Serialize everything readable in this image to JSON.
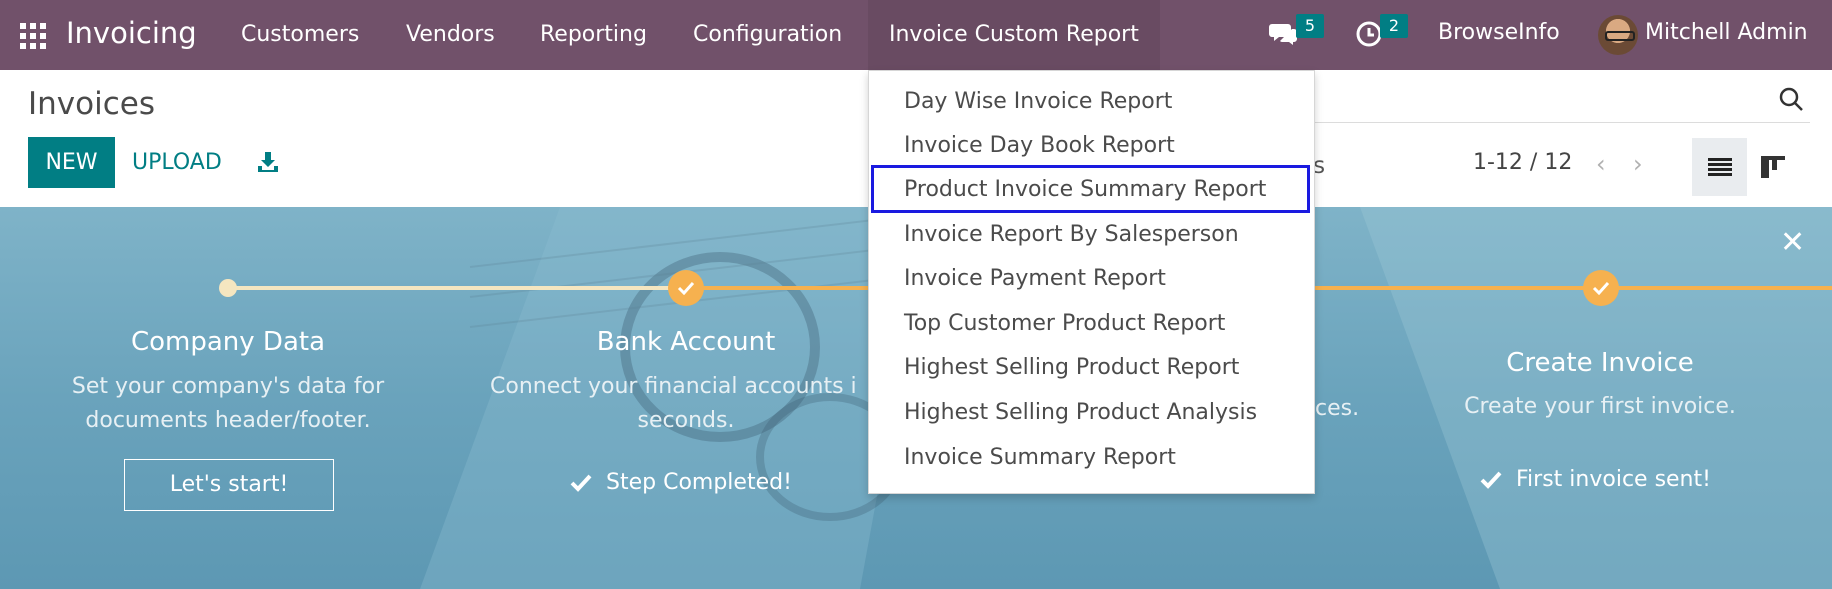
{
  "navbar": {
    "app_name": "Invoicing",
    "menu": [
      "Customers",
      "Vendors",
      "Reporting",
      "Configuration",
      "Invoice Custom Report"
    ],
    "messages_count": "5",
    "activities_count": "2",
    "company": "BrowseInfo",
    "user": "Mitchell Admin"
  },
  "control_panel": {
    "title": "Invoices",
    "new_label": "NEW",
    "upload_label": "UPLOAD",
    "filter_partial": "tes",
    "pager": "1-12 / 12"
  },
  "dropdown": {
    "items": [
      "Day Wise Invoice Report",
      "Invoice Day Book Report",
      "Product Invoice Summary Report",
      "Invoice Report By Salesperson",
      "Invoice Payment Report",
      "Top Customer Product Report",
      "Highest Selling Product Report",
      "Highest Selling Product Analysis",
      "Invoice Summary Report"
    ],
    "highlighted_index": 2
  },
  "onboarding": {
    "steps": [
      {
        "title": "Company Data",
        "desc1": "Set your company's data for",
        "desc2": "documents header/footer.",
        "action": "Let's start!"
      },
      {
        "title": "Bank Account",
        "desc1": "Connect your financial accounts i",
        "desc2": "seconds.",
        "status": "Step Completed!"
      },
      {
        "desc_partial": "ces."
      },
      {
        "title": "Create Invoice",
        "desc1": "Create your first invoice.",
        "status": "First invoice sent!"
      }
    ]
  },
  "colors": {
    "navbar": "#71516a",
    "primary": "#017e84",
    "step_done": "#f6b14f",
    "highlight_border": "#1a1ae0"
  }
}
